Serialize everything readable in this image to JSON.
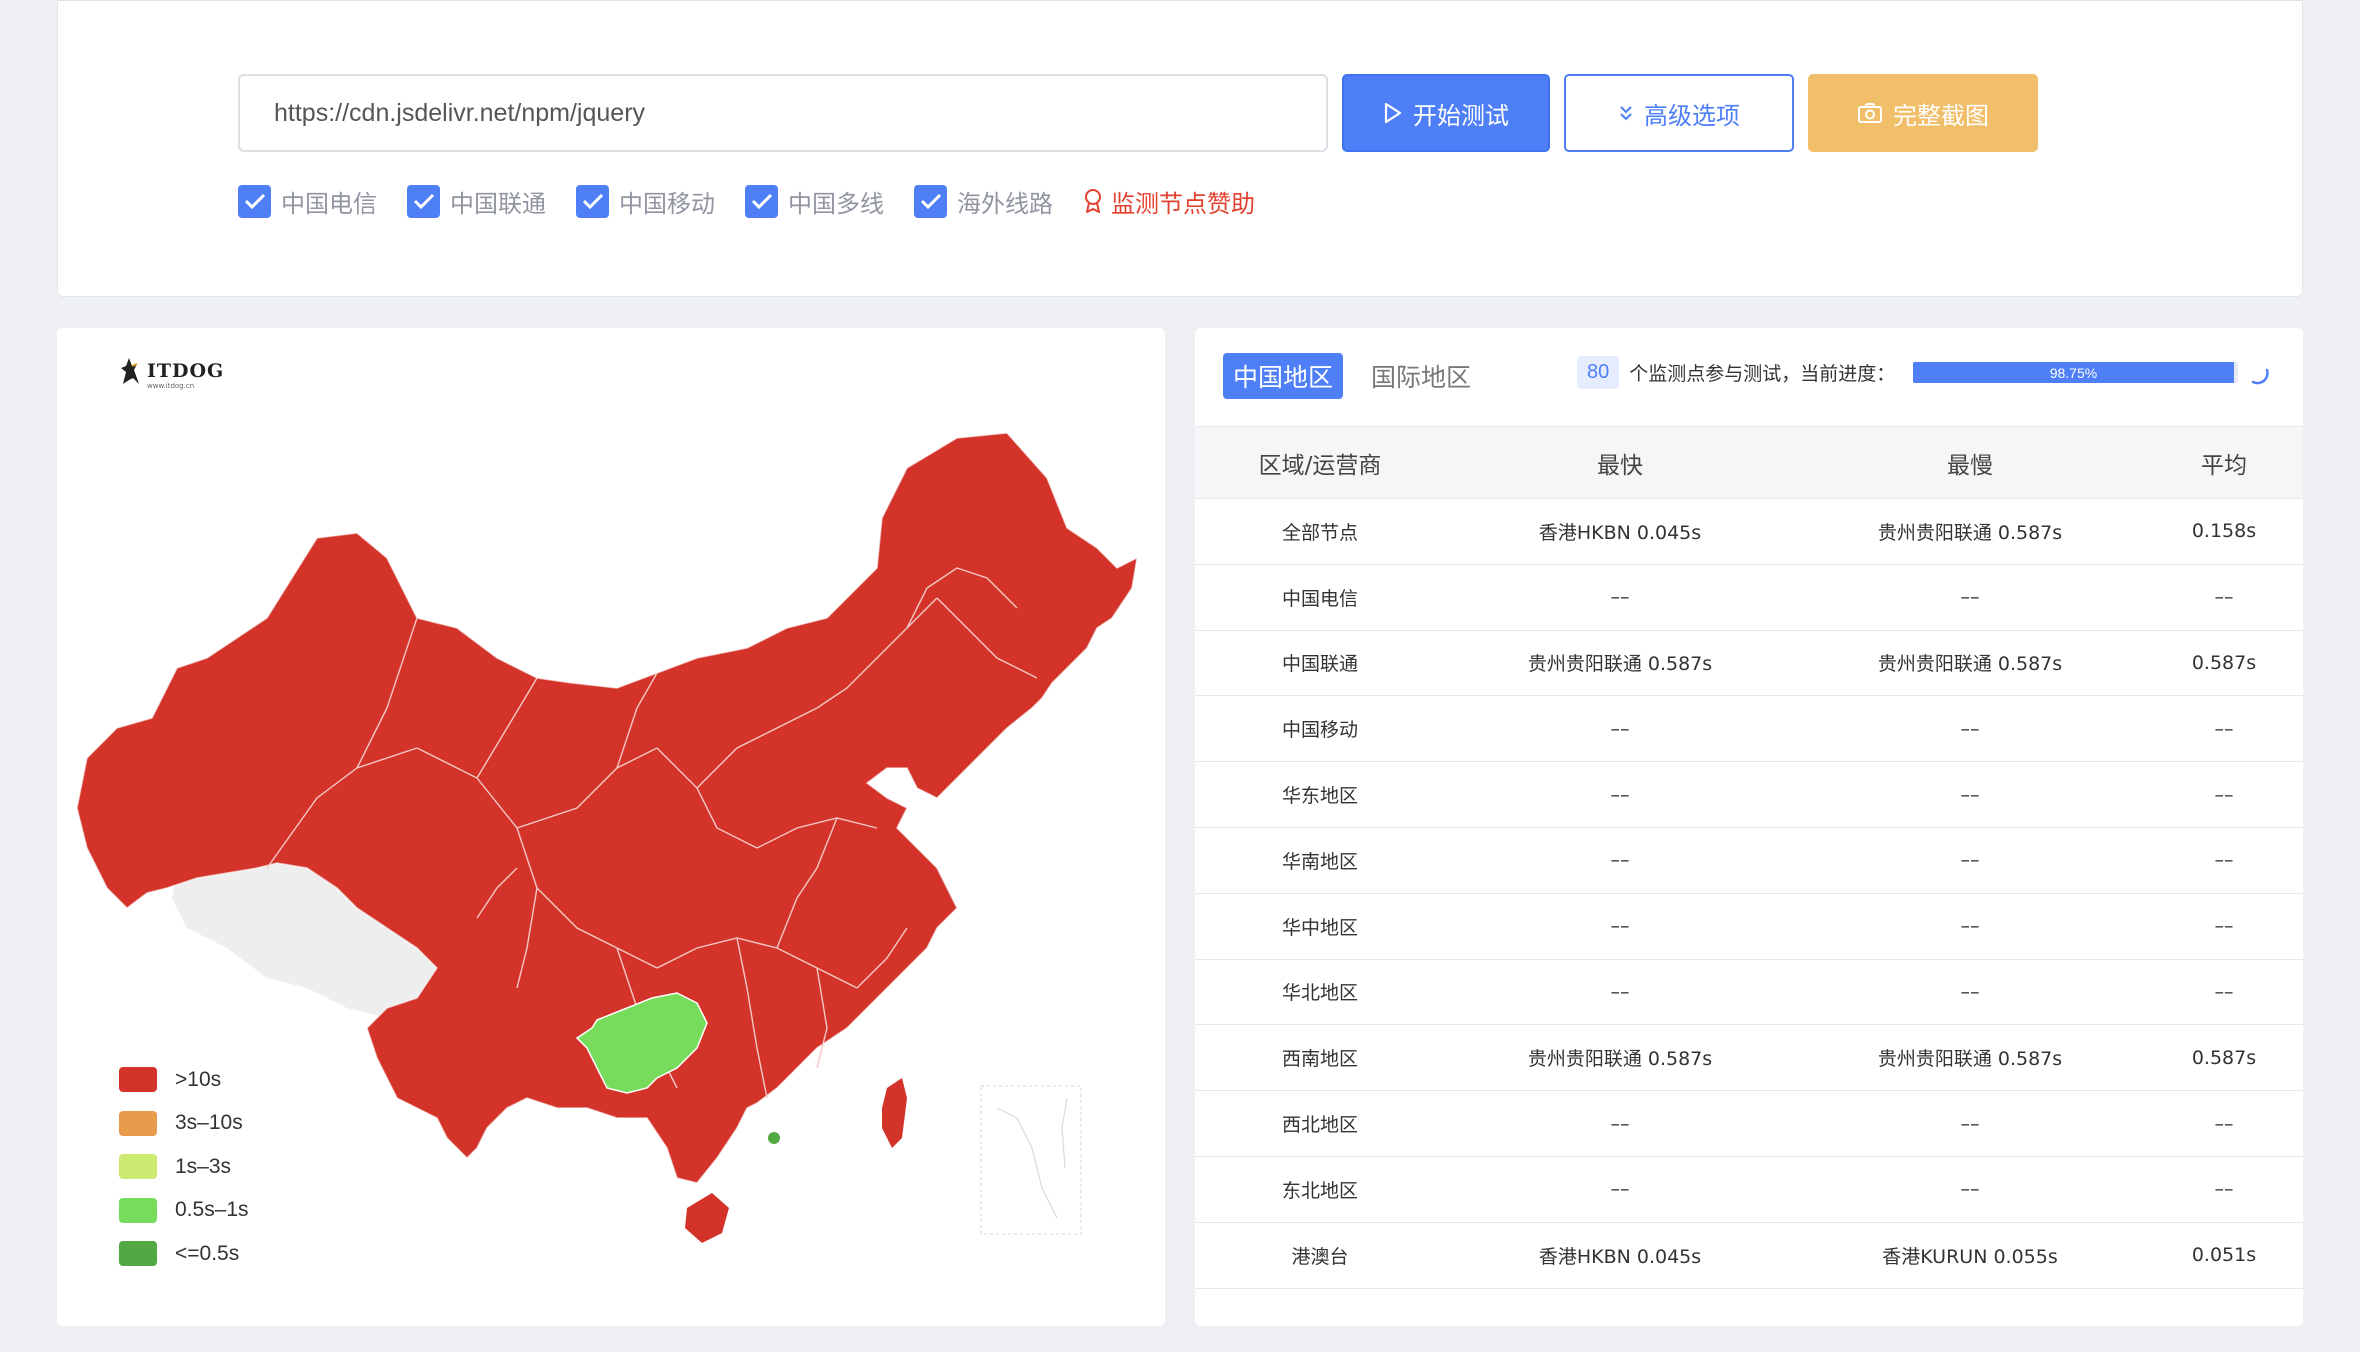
{
  "search": {
    "url_value": "https://cdn.jsdelivr.net/npm/jquery",
    "start_label": "开始测试",
    "advanced_label": "高级选项",
    "screenshot_label": "完整截图"
  },
  "filters": [
    {
      "label": "中国电信",
      "checked": true
    },
    {
      "label": "中国联通",
      "checked": true
    },
    {
      "label": "中国移动",
      "checked": true
    },
    {
      "label": "中国多线",
      "checked": true
    },
    {
      "label": "海外线路",
      "checked": true
    }
  ],
  "sponsor_label": "监测节点赞助",
  "map": {
    "logo_text": "ITDOG",
    "logo_sub": "www.itdog.cn",
    "colors": {
      "over10": "#d4332a",
      "s3to10": "#e89b4b",
      "s1to3": "#cdea72",
      "s05to1": "#77dc5b",
      "under05": "#52a843",
      "nodata": "#eeeeee"
    },
    "legend": [
      {
        "label": ">10s",
        "color": "#d4332a"
      },
      {
        "label": "3s–10s",
        "color": "#e89b4b"
      },
      {
        "label": "1s–3s",
        "color": "#cdea72"
      },
      {
        "label": "0.5s–1s",
        "color": "#77dc5b"
      },
      {
        "label": "<=0.5s",
        "color": "#52a843"
      }
    ]
  },
  "results": {
    "tabs": [
      {
        "label": "中国地区",
        "active": true
      },
      {
        "label": "国际地区",
        "active": false
      }
    ],
    "node_count": "80",
    "progress_text": "个监测点参与测试，当前进度：",
    "progress_percent": 98.75,
    "progress_label": "98.75%",
    "columns": [
      "区域/运营商",
      "最快",
      "最慢",
      "平均"
    ],
    "rows": [
      [
        "全部节点",
        "香港HKBN 0.045s",
        "贵州贵阳联通 0.587s",
        "0.158s"
      ],
      [
        "中国电信",
        "––",
        "––",
        "––"
      ],
      [
        "中国联通",
        "贵州贵阳联通 0.587s",
        "贵州贵阳联通 0.587s",
        "0.587s"
      ],
      [
        "中国移动",
        "––",
        "––",
        "––"
      ],
      [
        "华东地区",
        "––",
        "––",
        "––"
      ],
      [
        "华南地区",
        "––",
        "––",
        "––"
      ],
      [
        "华中地区",
        "––",
        "––",
        "––"
      ],
      [
        "华北地区",
        "––",
        "––",
        "––"
      ],
      [
        "西南地区",
        "贵州贵阳联通 0.587s",
        "贵州贵阳联通 0.587s",
        "0.587s"
      ],
      [
        "西北地区",
        "––",
        "––",
        "––"
      ],
      [
        "东北地区",
        "––",
        "––",
        "––"
      ],
      [
        "港澳台",
        "香港HKBN 0.045s",
        "香港KURUN 0.055s",
        "0.051s"
      ]
    ]
  }
}
